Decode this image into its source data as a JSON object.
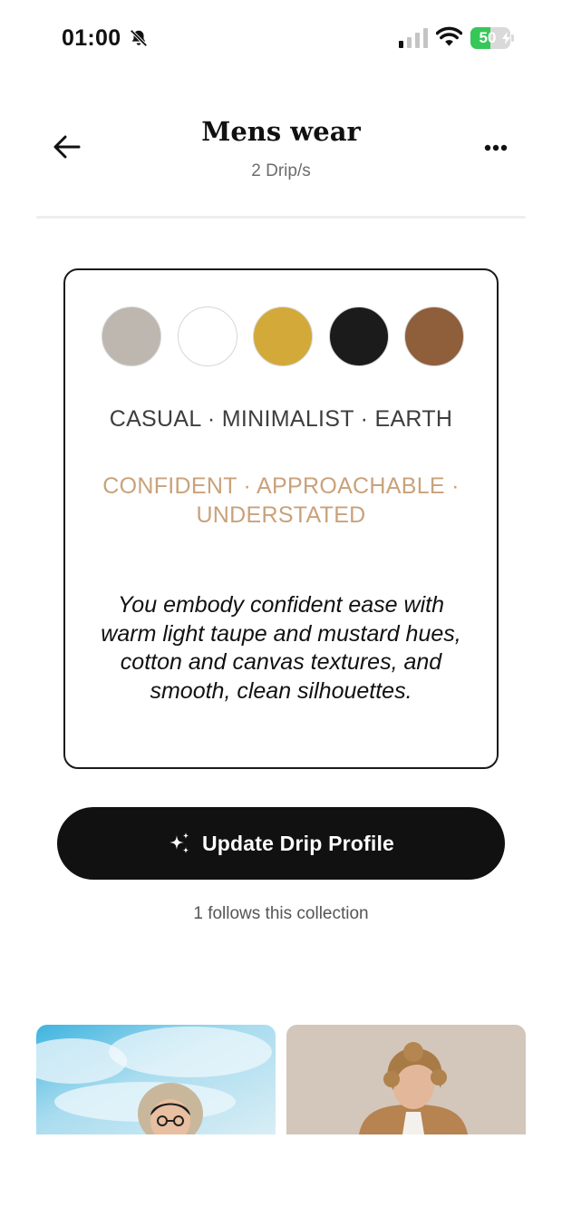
{
  "status_bar": {
    "time": "01:00",
    "battery_level": 50,
    "battery_label": "50",
    "icons": [
      "bell-off-icon",
      "cellular-signal-icon",
      "wifi-icon",
      "battery-charging-icon"
    ]
  },
  "header": {
    "title": "Mens wear",
    "subtitle": "2 Drip/s",
    "back_icon": "arrow-left-icon",
    "more_icon": "ellipsis-icon"
  },
  "profile": {
    "swatches": [
      {
        "name": "light-taupe",
        "color": "#bdb7af"
      },
      {
        "name": "white",
        "color": "#ffffff"
      },
      {
        "name": "mustard",
        "color": "#d3aa39"
      },
      {
        "name": "black",
        "color": "#1b1b1b"
      },
      {
        "name": "brown",
        "color": "#8f5e3a"
      }
    ],
    "style_tags": "CASUAL · MINIMALIST · EARTH",
    "mood_tags": "CONFIDENT · APPROACHABLE · UNDERSTATED",
    "description": "You embody confident ease with warm light taupe and mustard hues, cotton and canvas textures, and smooth, clean silhouettes."
  },
  "actions": {
    "update_label": "Update Drip Profile",
    "update_icon": "sparkle-icon"
  },
  "follows_text": "1 follows this collection",
  "gallery": {
    "items": [
      {
        "name": "man-in-hat-sky-photo"
      },
      {
        "name": "man-curly-hair-photo"
      }
    ]
  },
  "colors": {
    "accent_mood": "#c9a27a",
    "button_bg": "#111111",
    "battery_green": "#36c759"
  }
}
